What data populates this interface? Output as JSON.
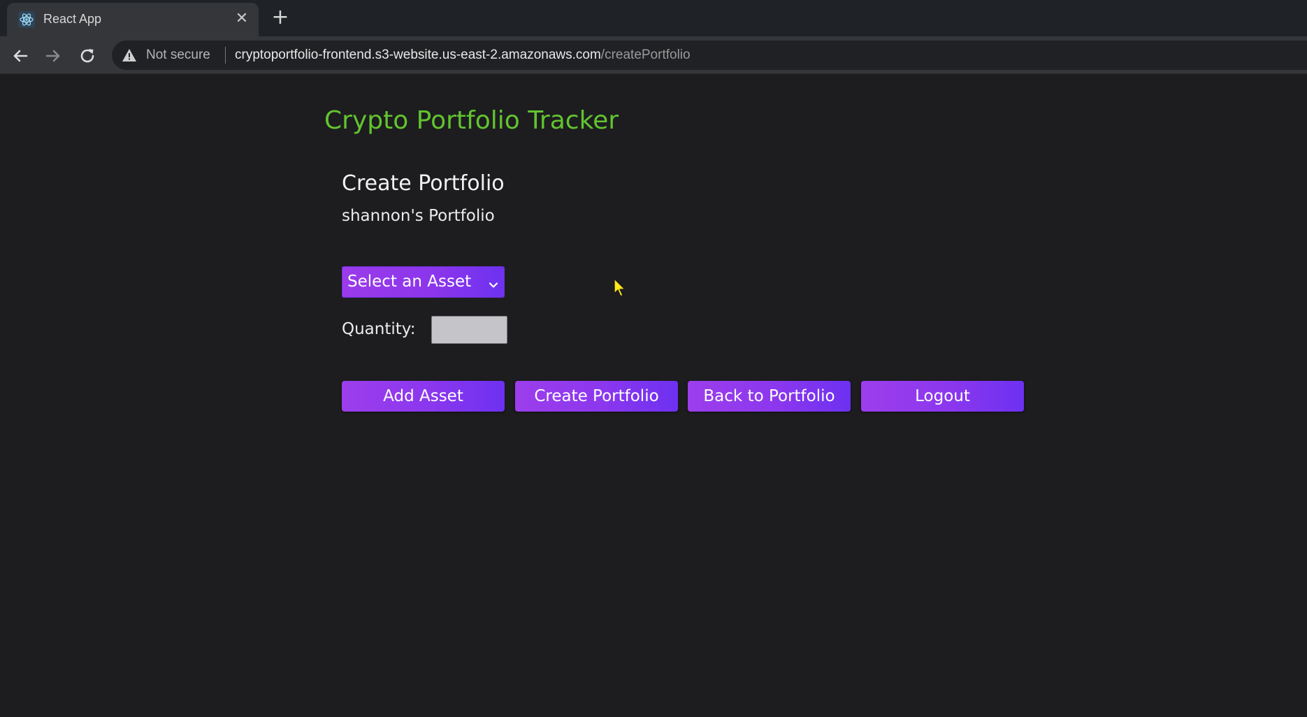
{
  "browser": {
    "tab": {
      "title": "React App",
      "close_glyph": "✕",
      "favicon": "react-icon"
    },
    "new_tab_glyph": "+",
    "security_label": "Not secure",
    "url_host": "cryptoportfolio-frontend.s3-website.us-east-2.amazonaws.com",
    "url_path": "/createPortfolio"
  },
  "page": {
    "app_title": "Crypto Portfolio Tracker",
    "section_heading": "Create Portfolio",
    "portfolio_name": "shannon's Portfolio",
    "asset_select": {
      "selected": "Select an Asset"
    },
    "quantity": {
      "label": "Quantity:",
      "value": ""
    },
    "buttons": {
      "add_asset": "Add Asset",
      "create_portfolio": "Create Portfolio",
      "back_to_portfolio": "Back to Portfolio",
      "logout": "Logout"
    }
  },
  "colors": {
    "page_background": "#1d1d20",
    "title_green": "#62c42e",
    "button_purple": "#8b37ee",
    "button_violet": "#6d31f1",
    "input_grey": "#c5c4c9",
    "cursor_yellow": "#ffe81a"
  }
}
